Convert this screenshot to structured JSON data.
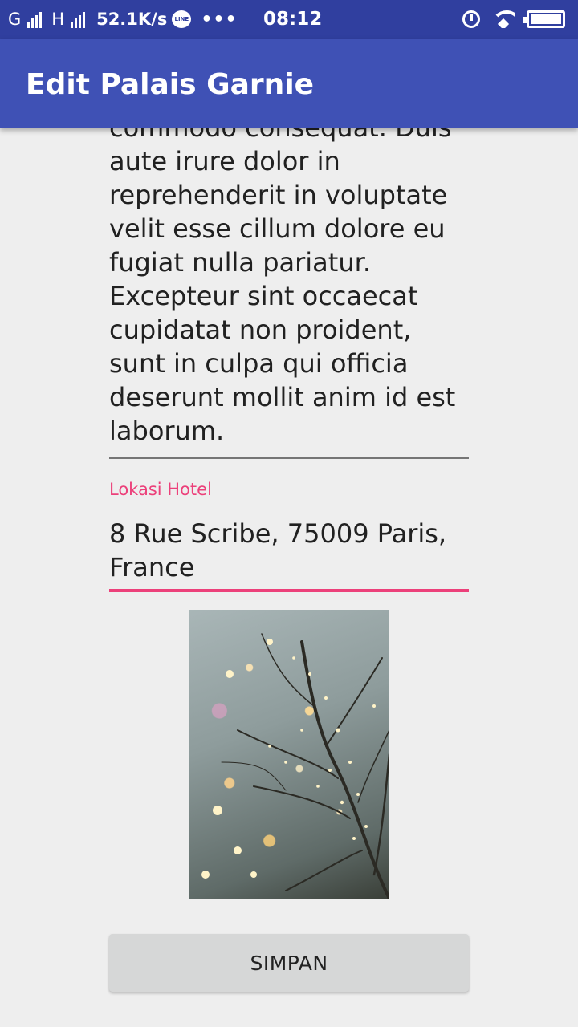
{
  "status_bar": {
    "carrier1": "G",
    "carrier2": "H",
    "speed": "52.1K/s",
    "line_badge": "LINE",
    "more": "•••",
    "time": "08:12"
  },
  "app_bar": {
    "title": "Edit Palais Garnie"
  },
  "form": {
    "description": "commodo consequat. Duis aute irure dolor in reprehenderit in voluptate velit esse cillum dolore eu fugiat nulla pariatur. Excepteur sint occaecat cupidatat non proident, sunt in culpa qui officia deserunt mollit anim id est laborum.",
    "location_label": "Lokasi Hotel",
    "location_value": "8 Rue Scribe, 75009 Paris, France",
    "accent_color": "#ec407a"
  },
  "photo": {
    "icon": "hotel-photo"
  },
  "actions": {
    "save_label": "SIMPAN"
  }
}
